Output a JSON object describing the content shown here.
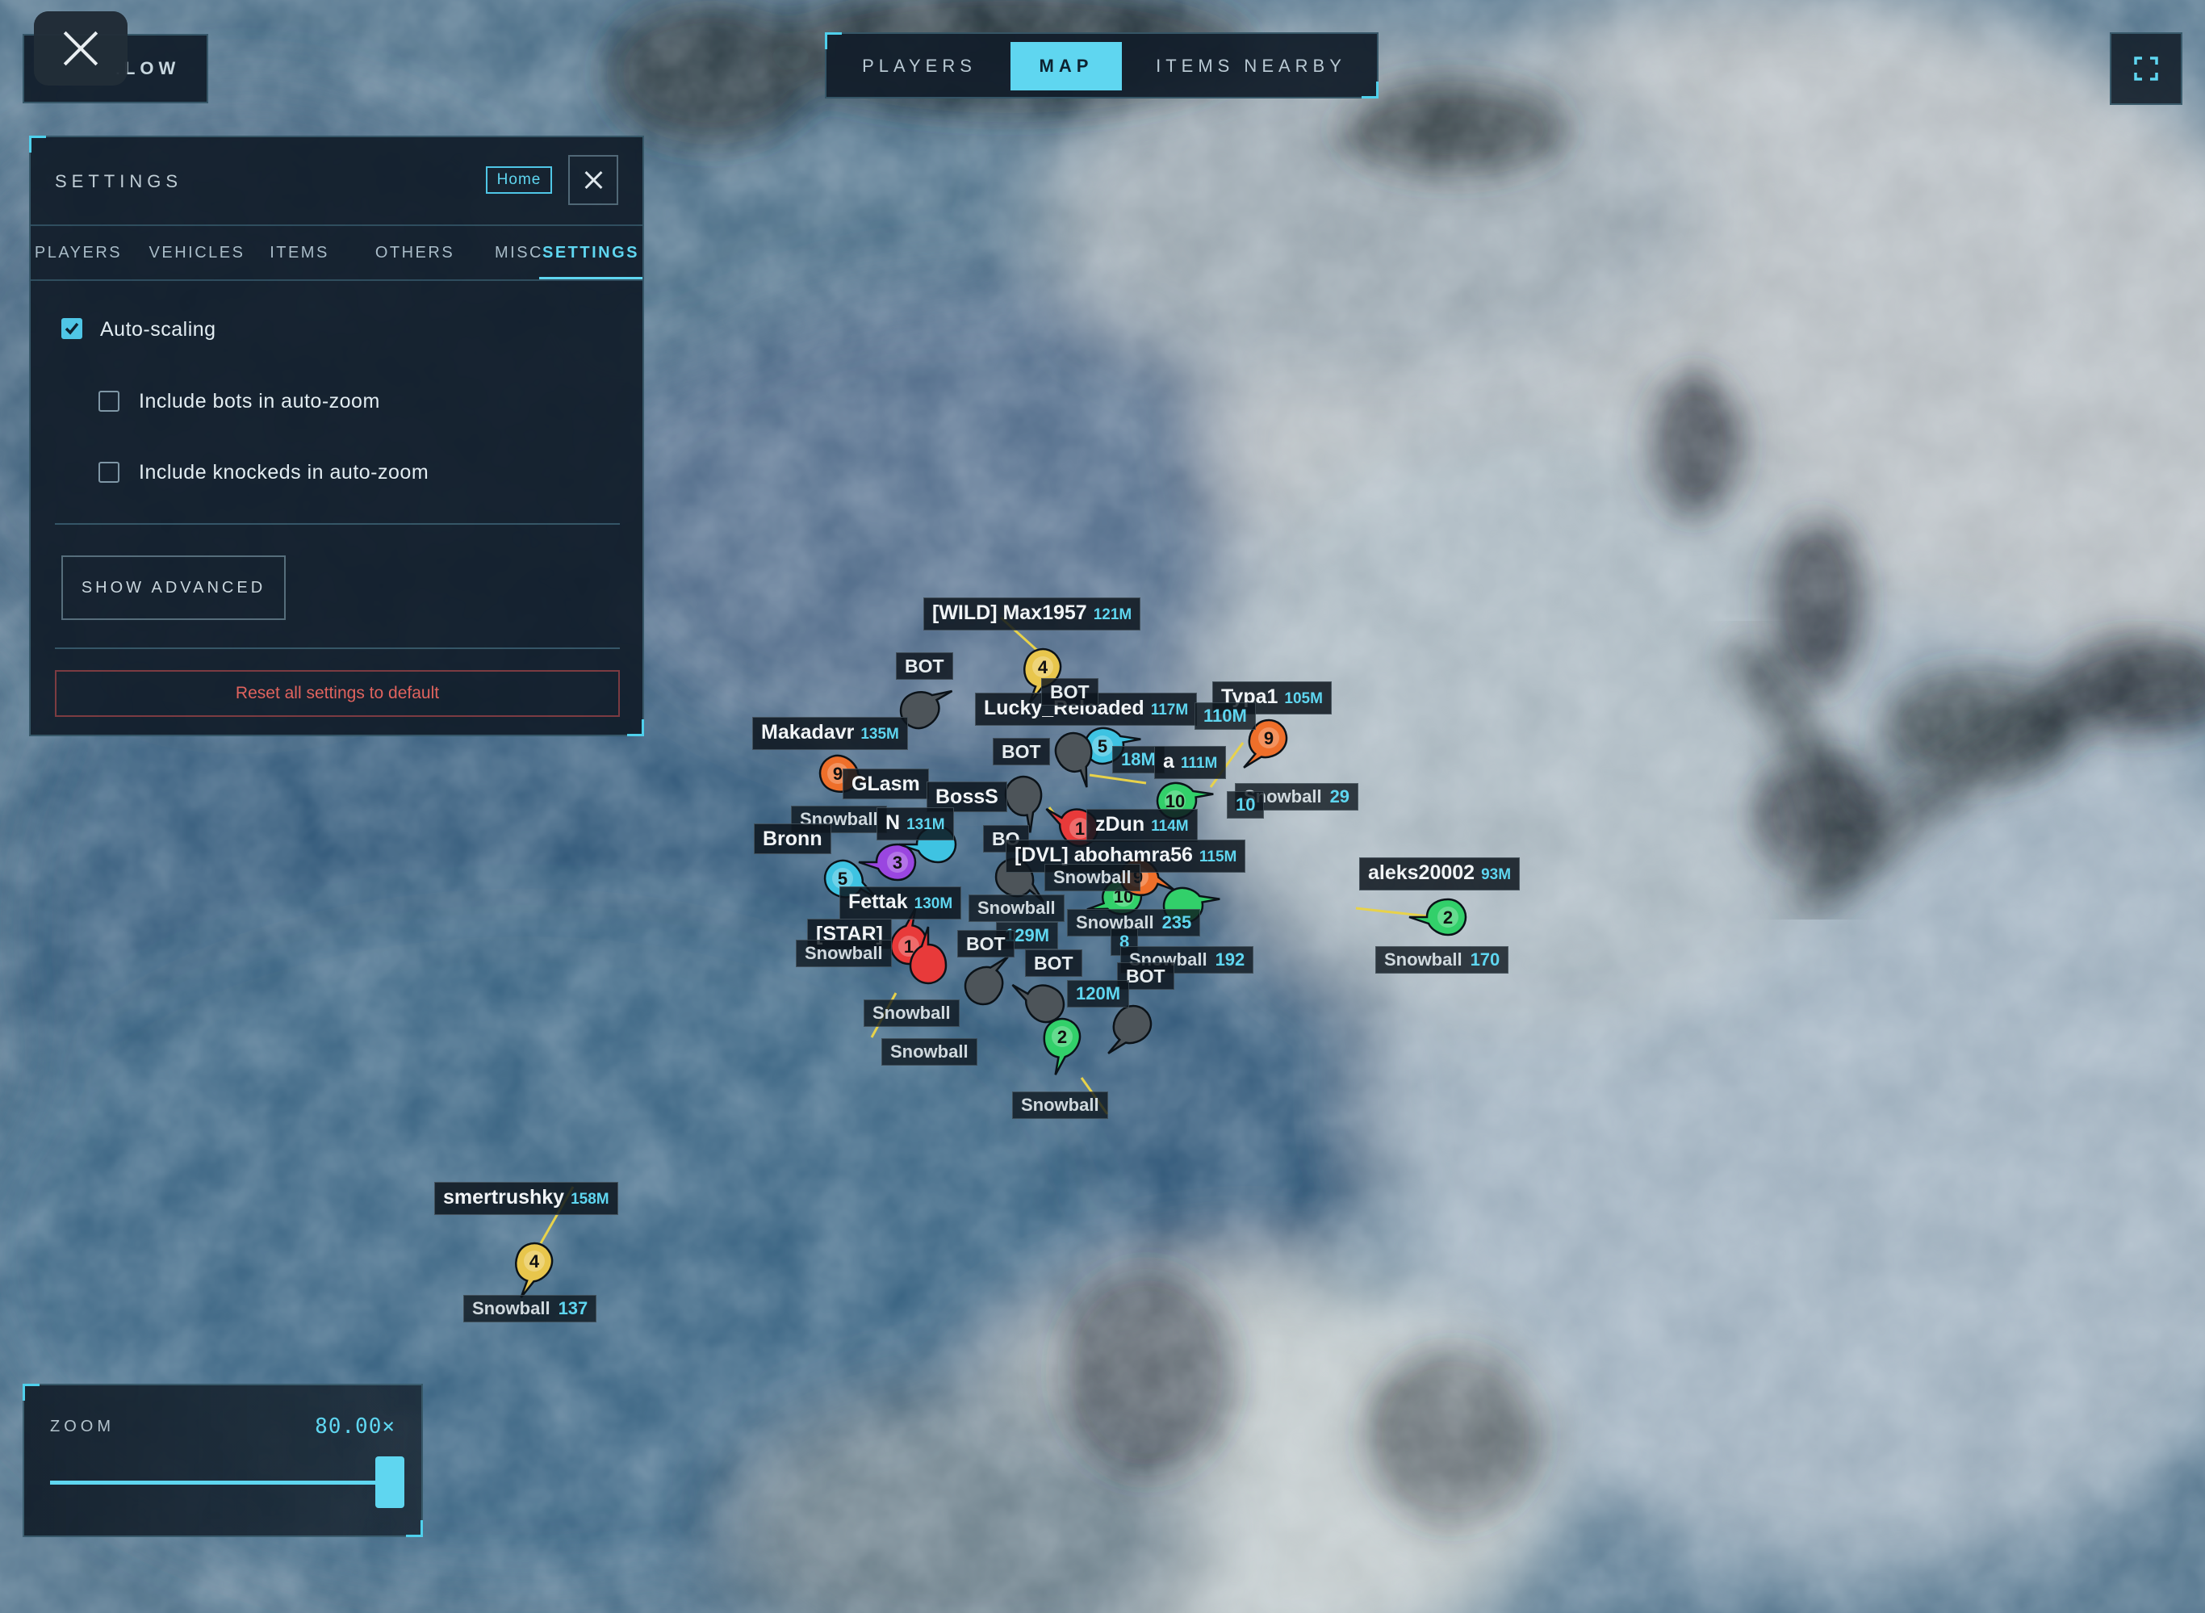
{
  "close_button_label": "×",
  "follow_button_label": "FOLLOW",
  "top_tabs": [
    {
      "label": "PLAYERS"
    },
    {
      "label": "MAP"
    },
    {
      "label": "ITEMS NEARBY"
    }
  ],
  "settings": {
    "title": "SETTINGS",
    "home_label": "Home",
    "tabs": [
      "PLAYERS",
      "VEHICLES",
      "ITEMS",
      "OTHERS",
      "MISC",
      "SETTINGS"
    ],
    "active_tab": "SETTINGS",
    "auto_scaling": {
      "label": "Auto-scaling",
      "checked": true
    },
    "include_bots": {
      "label": "Include bots in auto-zoom",
      "checked": false
    },
    "include_knocked": {
      "label": "Include knockeds in auto-zoom",
      "checked": false
    },
    "show_advanced_label": "SHOW ADVANCED",
    "reset_label": "Reset all settings to default"
  },
  "zoom": {
    "label": "ZOOM",
    "value_text": "80.00×",
    "level_fraction": 0.98
  },
  "colors": {
    "accent": "#5fd6f0",
    "reset": "#e0635e",
    "green": "#32d06a",
    "yellow": "#e8c64c",
    "orange": "#ef6f2a",
    "red": "#e83a3a",
    "cyan": "#3ec3e2",
    "purple": "#9a46e0",
    "bot": "#4d5459"
  },
  "players": [
    {
      "name": "[WILD] Max1957",
      "dist": "121M",
      "team": "4",
      "color": "yellow",
      "weapon": ""
    },
    {
      "name": "Makadavr",
      "dist": "135M",
      "team": "",
      "color": "",
      "weapon": ""
    },
    {
      "name": "Lucky_Reloaded",
      "dist": "117M",
      "team": "",
      "color": "",
      "weapon": ""
    },
    {
      "name": "Typa1",
      "dist": "105M",
      "team": "9",
      "color": "orange",
      "weapon": ""
    },
    {
      "name": "aleks20002",
      "dist": "93M",
      "team": "2",
      "color": "green",
      "weapon": "Snowball",
      "weapon_count": "170"
    },
    {
      "name": "smertrushky",
      "dist": "158M",
      "team": "4",
      "color": "yellow",
      "weapon": "Snowball",
      "weapon_count": "137"
    },
    {
      "name": "Fettak",
      "dist": "130M",
      "team": "",
      "color": "",
      "weapon": ""
    },
    {
      "name": "[STAR]",
      "dist": "",
      "team": "1",
      "color": "red",
      "weapon": ""
    },
    {
      "name": "[DVL] abohamra56",
      "dist": "115M",
      "team": "",
      "color": "",
      "weapon": ""
    },
    {
      "name": "BossS",
      "dist": "",
      "team": "",
      "color": "",
      "weapon": ""
    },
    {
      "name": "GLasm",
      "dist": "",
      "team": "9",
      "color": "orange",
      "weapon": ""
    },
    {
      "name": "Bronn",
      "dist": "",
      "team": "",
      "color": "",
      "weapon": ""
    },
    {
      "name": "N",
      "dist": "131M",
      "team": "",
      "color": "",
      "weapon": "Snowball"
    },
    {
      "name": "zDun",
      "dist": "114M",
      "team": "1",
      "color": "red",
      "weapon": ""
    },
    {
      "name": "a",
      "dist": "111M",
      "team": "",
      "color": "",
      "weapon": ""
    }
  ],
  "misc_labels": {
    "bot": "BOT",
    "snowball": "Snowball",
    "d_110": "110M",
    "d_118": "18M",
    "d_129": "129M",
    "d_120": "120M",
    "snowball_235": "235",
    "snowball_192": "192",
    "snowball_29": "29",
    "team_10": "10",
    "team_5": "5",
    "team_3": "3",
    "team_8": "8",
    "team_2": "2",
    "team_9": "9"
  }
}
